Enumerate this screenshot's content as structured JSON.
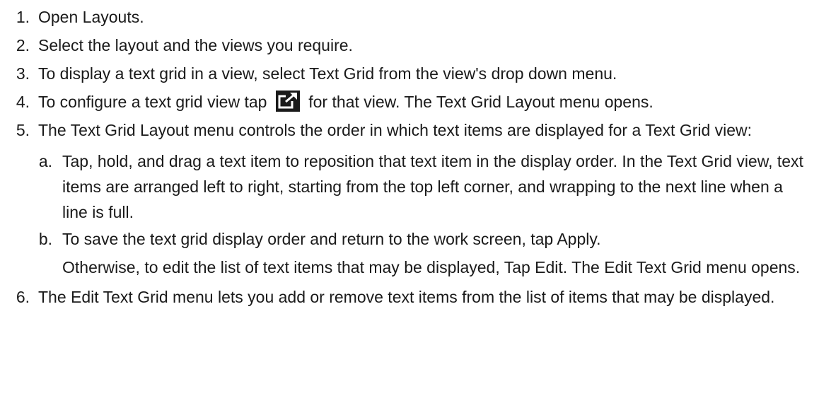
{
  "steps": [
    {
      "num": "1.",
      "text": "Open Layouts."
    },
    {
      "num": "2.",
      "text": "Select the layout and the views you require."
    },
    {
      "num": "3.",
      "text": "To display a text grid in a view, select Text Grid from the view's drop down menu."
    },
    {
      "num": "4.",
      "text_before": "To configure a text grid view tap",
      "text_after": "for that view. The Text Grid Layout menu opens.",
      "icon": "edit-layout-icon"
    },
    {
      "num": "5.",
      "text": "The Text Grid Layout menu controls the order in which text items are displayed for a Text Grid view:",
      "sub": [
        {
          "num": "a.",
          "text": "Tap, hold, and drag a text item to reposition that text item in the display order. In the Text Grid view, text items are arranged left to right, starting from the top left corner, and wrapping to the next line when a line is full."
        },
        {
          "num": "b.",
          "text": "To save the text grid display order and return to the work screen, tap Apply.",
          "para": "Otherwise, to edit the list of text items that may be displayed, Tap Edit. The Edit Text Grid menu opens."
        }
      ]
    },
    {
      "num": "6.",
      "text": "The Edit Text Grid menu lets you add or remove text items from the list of items that may be displayed."
    }
  ]
}
